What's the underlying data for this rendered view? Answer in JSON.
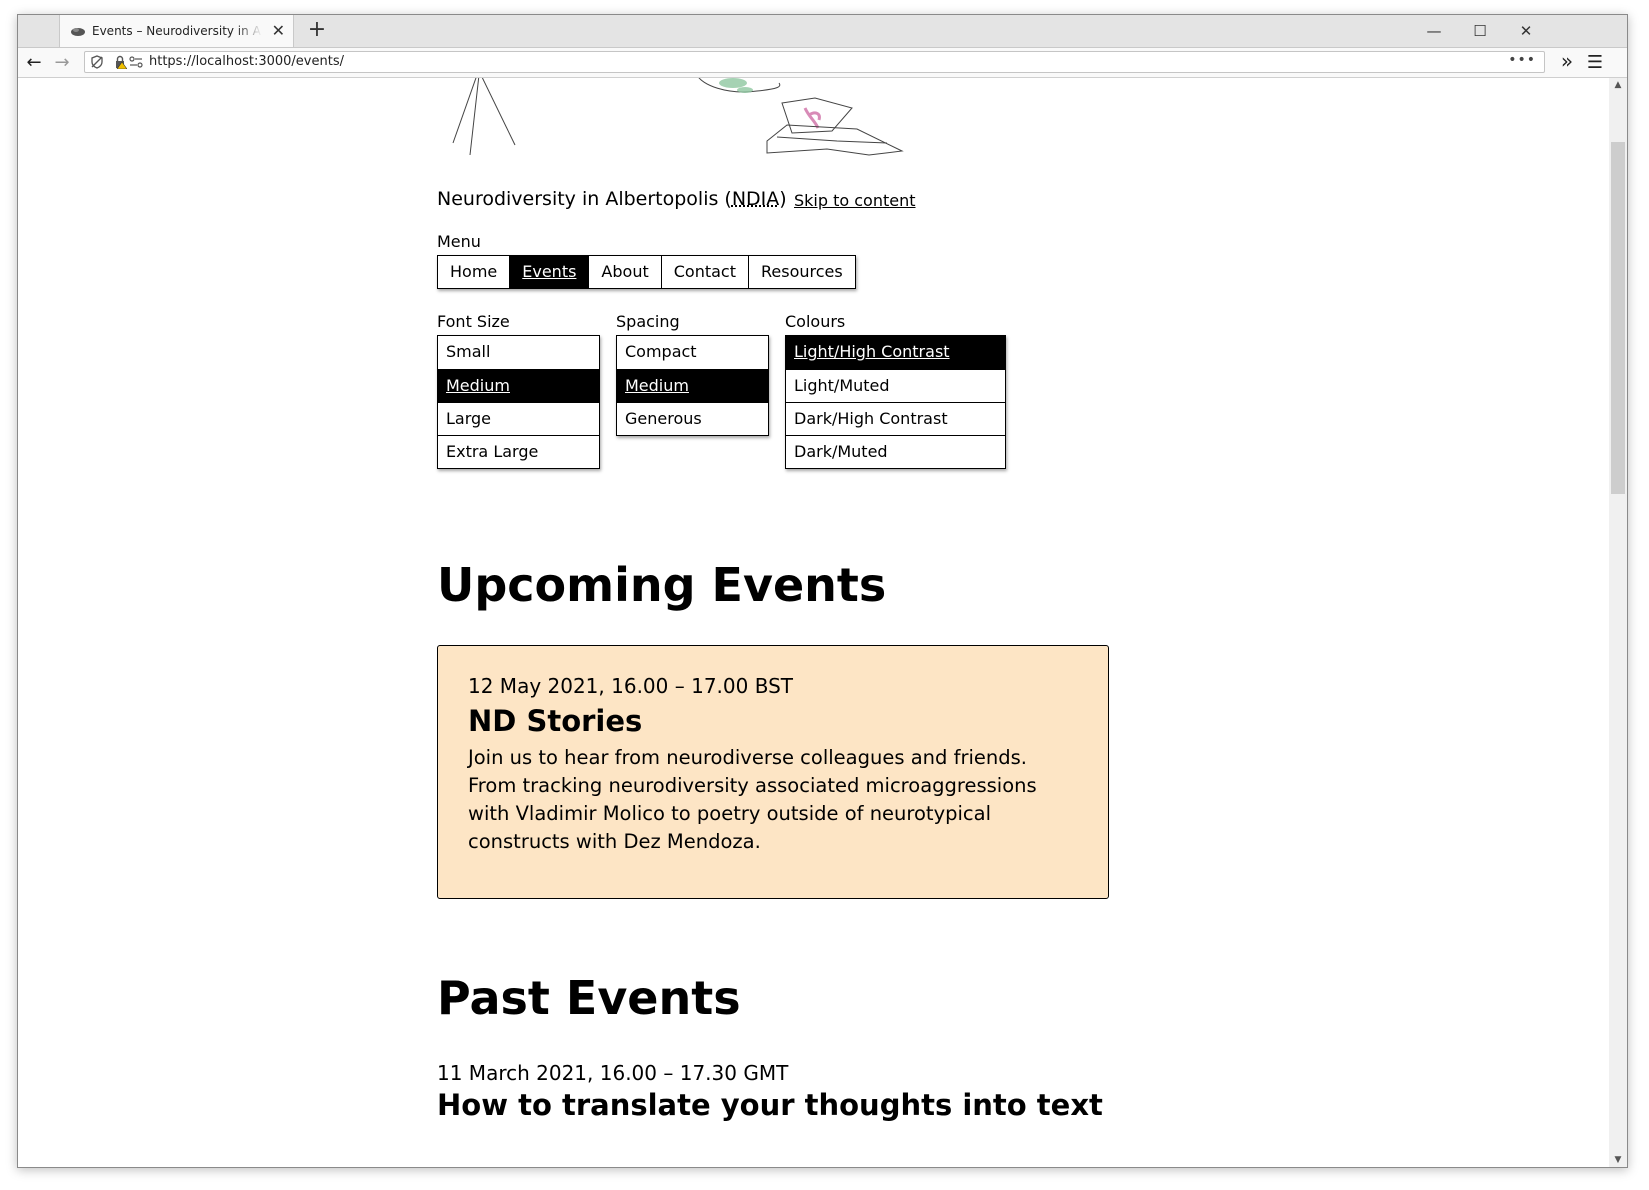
{
  "browser": {
    "tab_title": "Events – Neurodiversity in Albertopolis",
    "url": "https://localhost:3000/events/",
    "new_tab": "+",
    "tab_close": "✕",
    "minimize": "—",
    "maximize": "☐",
    "close": "✕",
    "back": "←",
    "forward": "→",
    "overflow": "•••",
    "extensions": "»",
    "menu": "☰"
  },
  "site": {
    "title_prefix": "Neurodiversity in Albertopolis (",
    "title_abbr": "NDIA",
    "title_suffix": ")",
    "skip_link": "Skip to content",
    "menu_label": "Menu",
    "menu_items": [
      {
        "label": "Home"
      },
      {
        "label": "Events"
      },
      {
        "label": "About"
      },
      {
        "label": "Contact"
      },
      {
        "label": "Resources"
      }
    ]
  },
  "settings": {
    "font_size": {
      "label": "Font Size",
      "options": [
        "Small",
        "Medium",
        "Large",
        "Extra Large"
      ],
      "selected": "Medium"
    },
    "spacing": {
      "label": "Spacing",
      "options": [
        "Compact",
        "Medium",
        "Generous"
      ],
      "selected": "Medium"
    },
    "colours": {
      "label": "Colours",
      "options": [
        "Light/High Contrast",
        "Light/Muted",
        "Dark/High Contrast",
        "Dark/Muted"
      ],
      "selected": "Light/High Contrast"
    }
  },
  "upcoming": {
    "heading": "Upcoming Events",
    "event": {
      "date": "12 May 2021, 16.00 – 17.00 BST",
      "title": "ND Stories",
      "description": "Join us to hear from neurodiverse colleagues and friends. From tracking neurodiversity associated microaggressions with Vladimir Molico to poetry outside of neurotypical constructs with Dez Mendoza."
    },
    "card_color": "#fde5c5"
  },
  "past": {
    "heading": "Past Events",
    "event": {
      "date": "11 March 2021, 16.00 – 17.30 GMT",
      "title": "How to translate your thoughts into text"
    }
  }
}
